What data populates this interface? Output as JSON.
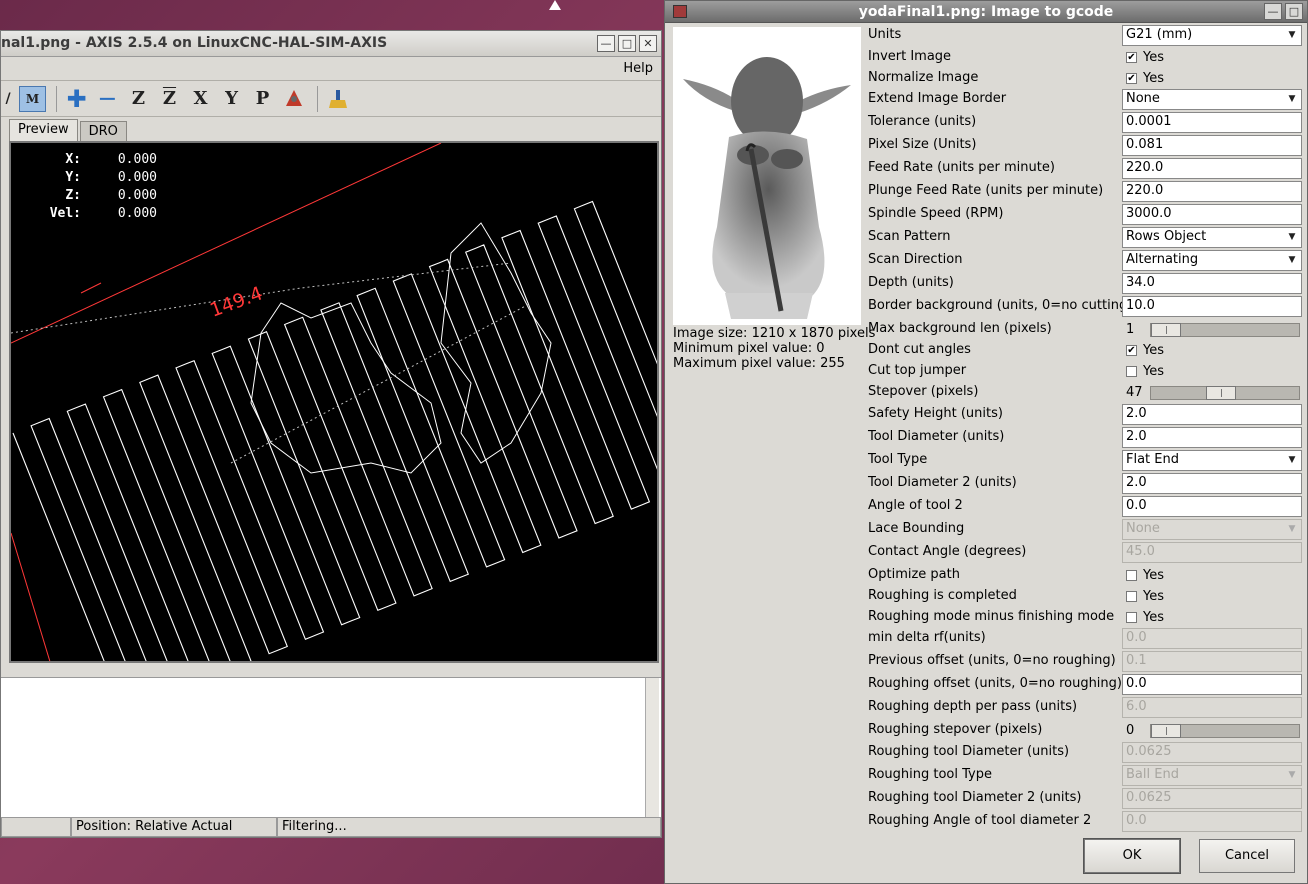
{
  "axis": {
    "title": "nal1.png - AXIS 2.5.4 on LinuxCNC-HAL-SIM-AXIS",
    "menu_help": "Help",
    "tabs": [
      "Preview",
      "DRO"
    ],
    "dro": [
      {
        "label": "X:",
        "value": "0.000"
      },
      {
        "label": "Y:",
        "value": "0.000"
      },
      {
        "label": "Z:",
        "value": "0.000"
      },
      {
        "label": "Vel:",
        "value": "0.000"
      }
    ],
    "dimension_label": "149.4",
    "status": {
      "position": "Position: Relative Actual",
      "filtering": "Filtering..."
    },
    "toolbar": {
      "zoom_in": "zoom-in-icon",
      "zoom_out": "zoom-out-icon",
      "view_z": "Z",
      "view_z2": "Z",
      "view_x": "X",
      "view_y": "Y",
      "view_p": "P",
      "rotate": "rotate-view-icon",
      "clear": "clear-live-plot-icon"
    },
    "colors": {
      "preview_bg": "#000000",
      "toolpath": "#ffffff",
      "extents": "#ff3838"
    }
  },
  "gcode": {
    "title": "yodaFinal1.png: Image to gcode",
    "image_info": {
      "size": "Image size: 1210 x 1870 pixels",
      "min": "Minimum pixel value: 0",
      "max": "Maximum pixel value: 255"
    },
    "params": [
      {
        "label": "Units",
        "type": "combo",
        "value": "G21 (mm)"
      },
      {
        "label": "Invert Image",
        "type": "check",
        "checked": true,
        "text": "Yes"
      },
      {
        "label": "Normalize Image",
        "type": "check",
        "checked": true,
        "text": "Yes"
      },
      {
        "label": "Extend Image Border",
        "type": "combo",
        "value": "None"
      },
      {
        "label": "Tolerance (units)",
        "type": "entry",
        "value": "0.0001"
      },
      {
        "label": "Pixel Size (Units)",
        "type": "entry",
        "value": "0.081"
      },
      {
        "label": "Feed Rate (units per minute)",
        "type": "entry",
        "value": "220.0"
      },
      {
        "label": "Plunge Feed Rate (units per minute)",
        "type": "entry",
        "value": "220.0"
      },
      {
        "label": "Spindle Speed (RPM)",
        "type": "entry",
        "value": "3000.0"
      },
      {
        "label": "Scan Pattern",
        "type": "combo",
        "value": "Rows Object"
      },
      {
        "label": "Scan Direction",
        "type": "combo",
        "value": "Alternating"
      },
      {
        "label": "Depth (units)",
        "type": "entry",
        "value": "34.0"
      },
      {
        "label": "Border background (units, 0=no cutting)",
        "type": "entry",
        "value": "10.0"
      },
      {
        "label": "Max background len (pixels)",
        "type": "slider",
        "value": "1",
        "fraction": 0.0
      },
      {
        "label": "Dont cut angles",
        "type": "check",
        "checked": true,
        "text": "Yes"
      },
      {
        "label": "Cut top jumper",
        "type": "check",
        "checked": false,
        "text": "Yes"
      },
      {
        "label": "Stepover (pixels)",
        "type": "slider",
        "value": "47",
        "fraction": 0.47
      },
      {
        "label": "Safety Height (units)",
        "type": "entry",
        "value": "2.0"
      },
      {
        "label": "Tool Diameter (units)",
        "type": "entry",
        "value": "2.0"
      },
      {
        "label": "Tool Type",
        "type": "combo",
        "value": "Flat End"
      },
      {
        "label": "Tool Diameter 2 (units)",
        "type": "entry",
        "value": "2.0"
      },
      {
        "label": "Angle of tool 2",
        "type": "entry",
        "value": "0.0"
      },
      {
        "label": "Lace Bounding",
        "type": "combo",
        "value": "None",
        "disabled": true
      },
      {
        "label": "Contact Angle (degrees)",
        "type": "entry",
        "value": "45.0",
        "disabled": true
      },
      {
        "label": "Optimize path",
        "type": "check",
        "checked": false,
        "text": "Yes"
      },
      {
        "label": "Roughing is completed",
        "type": "check",
        "checked": false,
        "text": "Yes"
      },
      {
        "label": "Roughing mode minus finishing mode",
        "type": "check",
        "checked": false,
        "text": "Yes"
      },
      {
        "label": "min delta rf(units)",
        "type": "entry",
        "value": "0.0",
        "disabled": true
      },
      {
        "label": "Previous offset (units, 0=no roughing)",
        "type": "entry",
        "value": "0.1",
        "disabled": true
      },
      {
        "label": "Roughing offset (units, 0=no roughing)",
        "type": "entry",
        "value": "0.0"
      },
      {
        "label": "Roughing depth per pass (units)",
        "type": "entry",
        "value": "6.0",
        "disabled": true
      },
      {
        "label": "Roughing stepover (pixels)",
        "type": "slider",
        "value": "0",
        "fraction": 0.0
      },
      {
        "label": "Roughing tool Diameter (units)",
        "type": "entry",
        "value": "0.0625",
        "disabled": true
      },
      {
        "label": "Roughing tool Type",
        "type": "combo",
        "value": "Ball End",
        "disabled": true
      },
      {
        "label": "Roughing tool Diameter 2 (units)",
        "type": "entry",
        "value": "0.0625",
        "disabled": true
      },
      {
        "label": "Roughing Angle of tool diameter 2",
        "type": "entry",
        "value": "0.0",
        "disabled": true
      }
    ],
    "ok_label": "OK",
    "cancel_label": "Cancel"
  }
}
